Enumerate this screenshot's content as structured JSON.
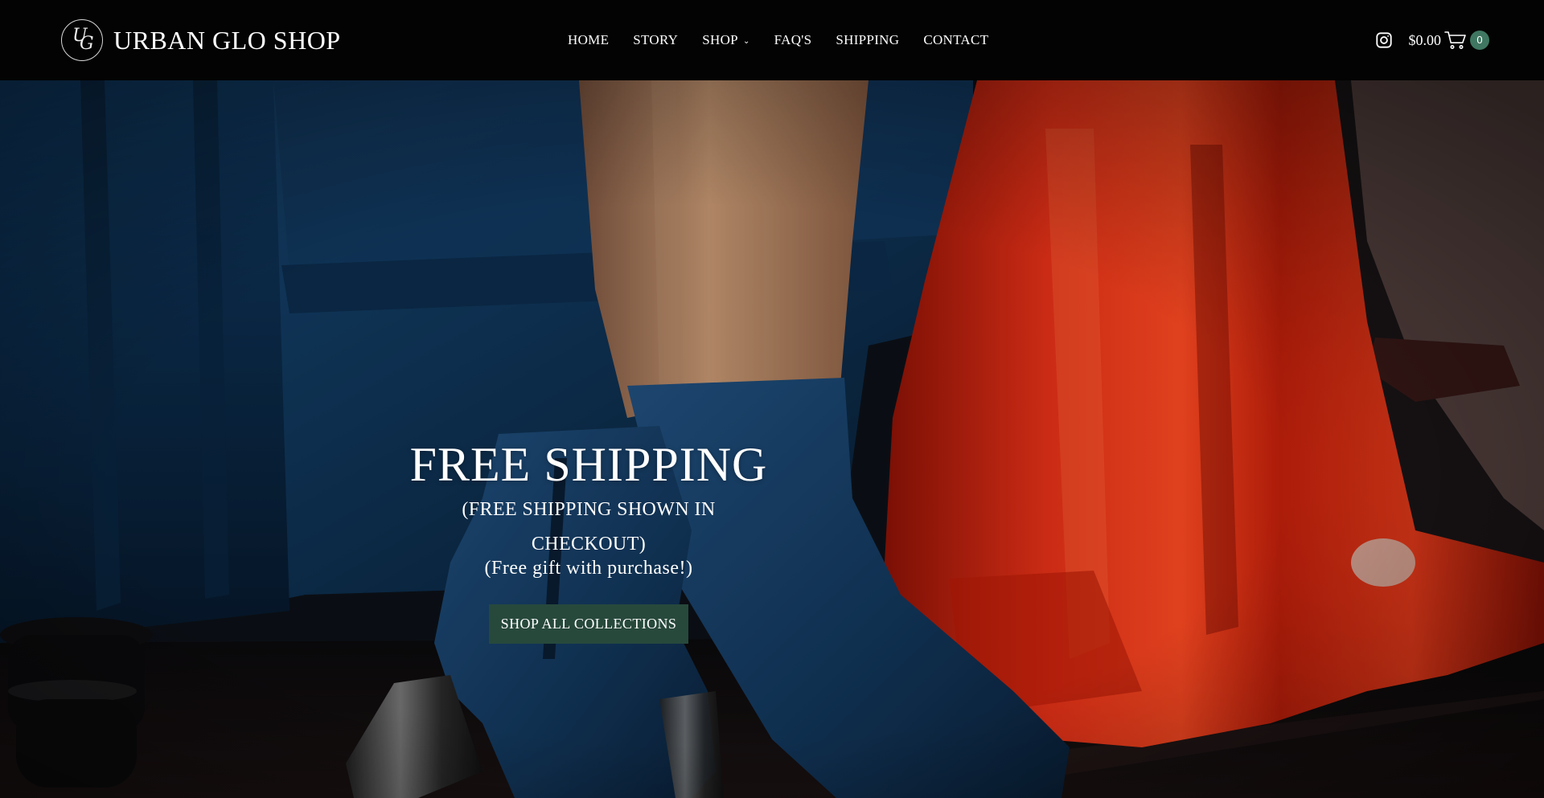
{
  "brand": {
    "name": "URBAN GLO SHOP",
    "monogram_top": "U",
    "monogram_bottom": "G"
  },
  "nav": {
    "items": [
      {
        "label": "HOME"
      },
      {
        "label": "STORY"
      },
      {
        "label": "SHOP",
        "has_dropdown": true
      },
      {
        "label": "FAQ'S"
      },
      {
        "label": "SHIPPING"
      },
      {
        "label": "CONTACT"
      }
    ]
  },
  "header_right": {
    "social_icon": "instagram-icon",
    "cart_total": "$0.00",
    "cart_icon": "cart-icon",
    "cart_count": "0"
  },
  "hero": {
    "title": "FREE SHIPPING",
    "subtitle": "(FREE SHIPPING SHOWN IN CHECKOUT)",
    "gift_note": "(Free gift with purchase!)",
    "cta_label": "SHOP ALL COLLECTIONS"
  },
  "colors": {
    "header_bg": "#030303",
    "cta_bg": "#27493c",
    "cart_badge": "#3f7762",
    "velvet_blue": "#12385f",
    "satin_red": "#e0260f"
  }
}
